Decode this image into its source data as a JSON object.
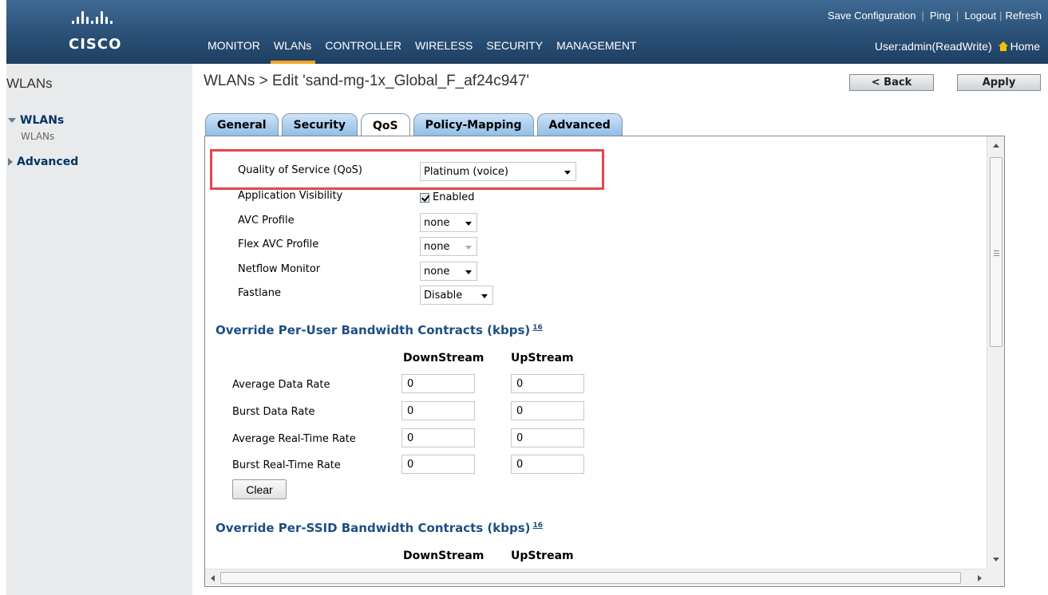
{
  "brand": {
    "name": "CISCO"
  },
  "top_links": {
    "save": "Save Configuration",
    "ping": "Ping",
    "logout": "Logout",
    "refresh": "Refresh"
  },
  "nav": {
    "items": [
      "MONITOR",
      "WLANs",
      "CONTROLLER",
      "WIRELESS",
      "SECURITY",
      "MANAGEMENT"
    ],
    "active": "WLANs"
  },
  "user": {
    "label": "User:admin(ReadWrite)",
    "home": "Home"
  },
  "sidebar": {
    "title": "WLANs",
    "wlans_label": "WLANs",
    "wlans_sub": "WLANs",
    "advanced_label": "Advanced"
  },
  "page": {
    "title": "WLANs > Edit  'sand-mg-1x_Global_F_af24c947'",
    "back_label": "< Back",
    "apply_label": "Apply"
  },
  "tabs": [
    "General",
    "Security",
    "QoS",
    "Policy-Mapping",
    "Advanced"
  ],
  "active_tab": "QoS",
  "qos": {
    "quality_label": "Quality of Service (QoS)",
    "quality_value": "Platinum (voice)",
    "app_vis_label": "Application Visibility",
    "app_vis_value": "Enabled",
    "avc_label": "AVC Profile",
    "avc_value": "none",
    "flex_avc_label": "Flex AVC Profile",
    "flex_avc_value": "none",
    "netflow_label": "Netflow Monitor",
    "netflow_value": "none",
    "fastlane_label": "Fastlane",
    "fastlane_value": "Disable"
  },
  "per_user": {
    "title": "Override Per-User Bandwidth Contracts (kbps)",
    "footnote": "16",
    "col_down": "DownStream",
    "col_up": "UpStream",
    "rows": [
      {
        "label": "Average Data Rate",
        "down": "0",
        "up": "0"
      },
      {
        "label": "Burst Data Rate",
        "down": "0",
        "up": "0"
      },
      {
        "label": "Average Real-Time Rate",
        "down": "0",
        "up": "0"
      },
      {
        "label": "Burst Real-Time Rate",
        "down": "0",
        "up": "0"
      }
    ],
    "clear_label": "Clear"
  },
  "per_ssid": {
    "title": "Override Per-SSID Bandwidth Contracts (kbps)",
    "footnote": "16",
    "col_down": "DownStream",
    "col_up": "UpStream"
  },
  "colors": {
    "header": "#2a5077",
    "accent": "#f5a623",
    "highlight": "#e2474c",
    "section": "#1c4f82"
  }
}
